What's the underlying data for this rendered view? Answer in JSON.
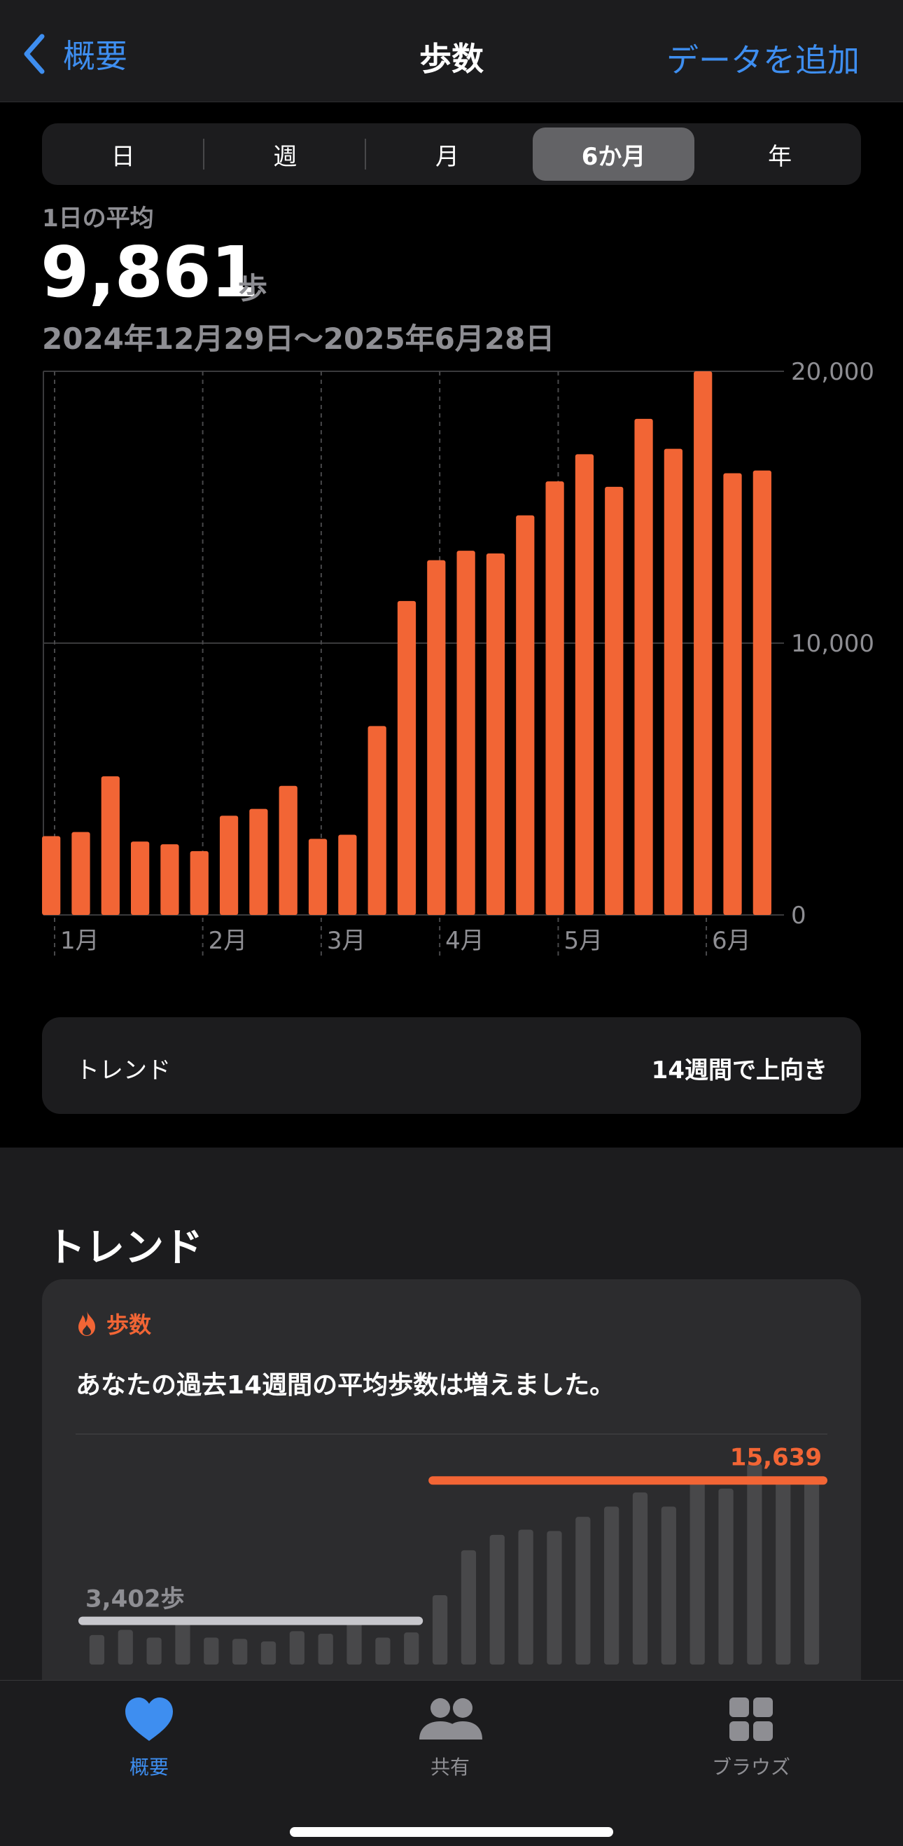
{
  "nav": {
    "back_label": "概要",
    "title": "歩数",
    "add_label": "データを追加"
  },
  "segments": [
    "日",
    "週",
    "月",
    "6か月",
    "年"
  ],
  "selected_segment": "6か月",
  "summary": {
    "label": "1日の平均",
    "value": "9,861",
    "unit": "歩",
    "date_range": "2024年12月29日〜2025年6月28日"
  },
  "chart_data": {
    "type": "bar",
    "title": "",
    "xlabel": "",
    "ylabel": "",
    "ylim": [
      0,
      20000
    ],
    "y_ticks": [
      "0",
      "10,000",
      "20,000"
    ],
    "month_labels": [
      "1月",
      "2月",
      "3月",
      "4月",
      "5月",
      "6月"
    ],
    "month_start_index": [
      0,
      5,
      9,
      13,
      17,
      22
    ],
    "bar_color": "#f26535",
    "grid": true,
    "values": [
      2900,
      3050,
      5100,
      2700,
      2600,
      2350,
      3650,
      3900,
      4750,
      2800,
      2950,
      6950,
      11550,
      13050,
      13400,
      13300,
      14700,
      15950,
      16950,
      15750,
      18250,
      17150,
      20000,
      16250,
      16350
    ]
  },
  "trend_row": {
    "label": "トレンド",
    "value": "14週間で上向き"
  },
  "trends_section": {
    "title": "トレンド",
    "card": {
      "tag": "歩数",
      "text": "あなたの過去14週間の平均歩数は増えました。",
      "old_average_label": "3,402歩",
      "new_average_label": "15,639",
      "accent_color": "#f26535",
      "old_color": "#c7c7cc",
      "bars": [
        2300,
        2700,
        2100,
        3402,
        2100,
        2000,
        1800,
        2600,
        2400,
        3600,
        2100,
        2500,
        5400,
        8900,
        10100,
        10500,
        10400,
        11500,
        12300,
        13400,
        12300,
        14500,
        13700,
        15639,
        14300,
        14600
      ]
    }
  },
  "tabbar": {
    "items": [
      {
        "label": "概要",
        "icon": "heart-icon"
      },
      {
        "label": "共有",
        "icon": "people-icon"
      },
      {
        "label": "ブラウズ",
        "icon": "grid-icon"
      }
    ]
  }
}
